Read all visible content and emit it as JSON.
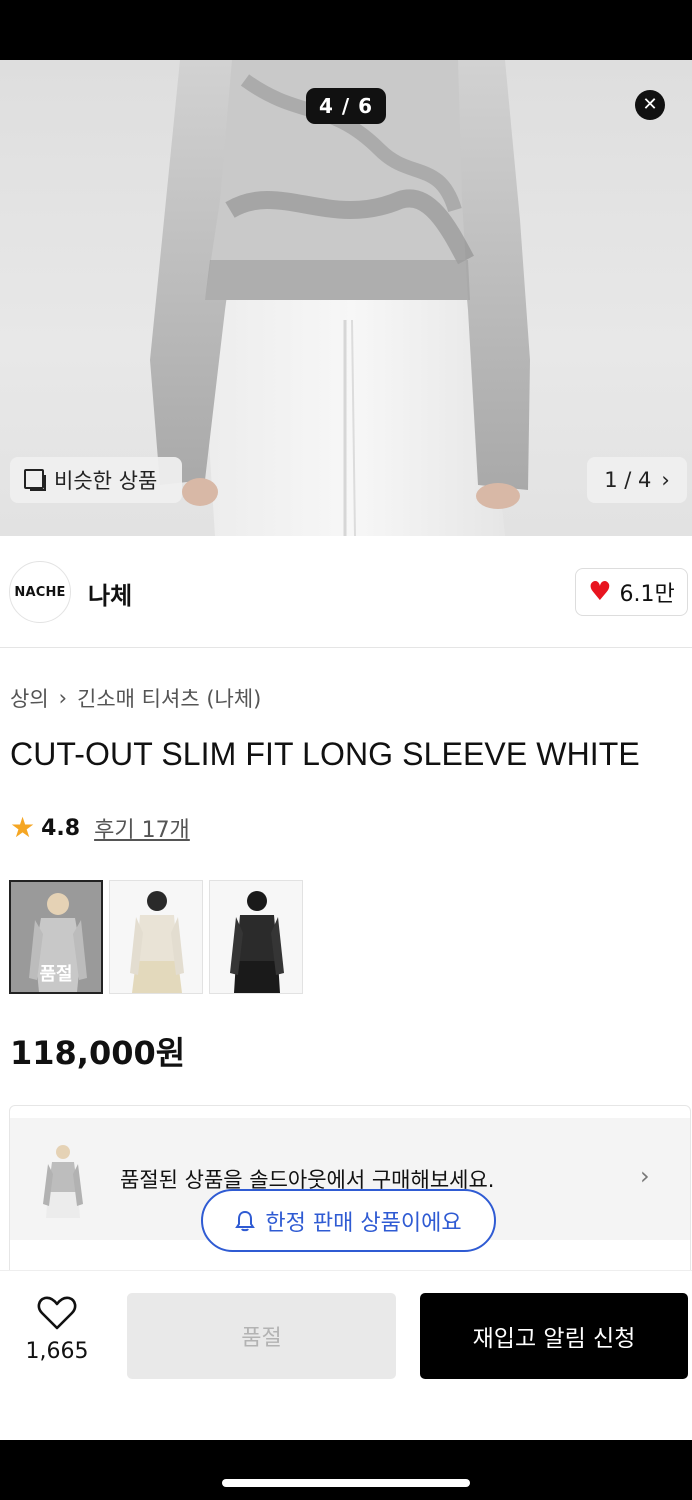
{
  "gallery": {
    "counter": "4 / 6",
    "close_icon": "close-icon",
    "similar_label": "비슷한 상품",
    "sub_counter": "1 / 4"
  },
  "brand": {
    "logo_text": "NACHE",
    "name": "나체",
    "like_count": "6.1만"
  },
  "breadcrumb": {
    "category": "상의",
    "subcategory": "긴소매 티셔츠 (나체)"
  },
  "product": {
    "title": "CUT-OUT SLIM FIT LONG SLEEVE WHITE",
    "rating": "4.8",
    "reviews": "후기 17개",
    "price": "118,000원",
    "colors": [
      {
        "variant": "white",
        "status": "품절"
      },
      {
        "variant": "ivory",
        "status": ""
      },
      {
        "variant": "black",
        "status": ""
      }
    ]
  },
  "banner": {
    "text": "품절된 상품을 솔드아웃에서 구매해보세요.",
    "limited_label": "한정 판매 상품이에요"
  },
  "bottom": {
    "wish_count": "1,665",
    "soldout_label": "품절",
    "restock_label": "재입고 알림 신청"
  },
  "colors": {
    "accent_blue": "#2f5bd3",
    "heart_red": "#e8141f",
    "star_orange": "#f5a623"
  }
}
